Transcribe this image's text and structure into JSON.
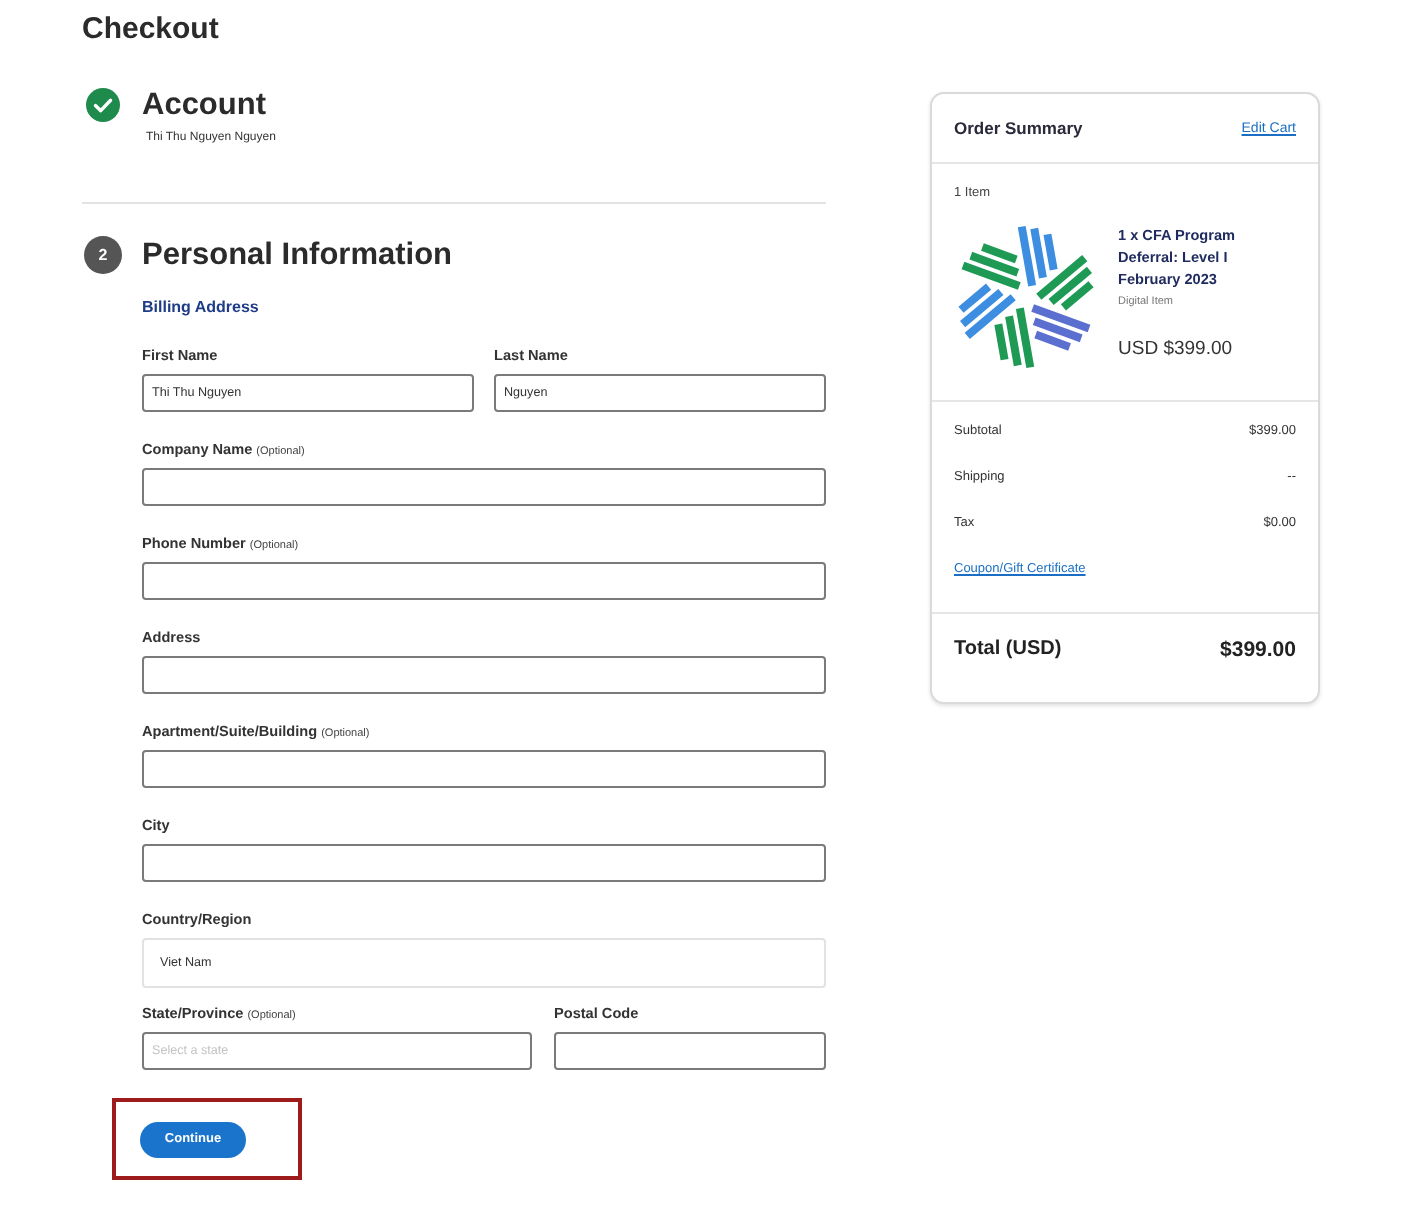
{
  "page": {
    "title": "Checkout"
  },
  "steps": [
    {
      "title": "Account",
      "completed": true,
      "summary": "Thi Thu Nguyen Nguyen"
    },
    {
      "title": "Personal Information",
      "completed": false,
      "number": "2",
      "form": {
        "heading": "Billing Address",
        "rows": [
          {
            "fields": [
              {
                "kind": "text",
                "label": "First Name",
                "value": "Thi Thu Nguyen"
              },
              {
                "kind": "text",
                "label": "Last Name",
                "value": "Nguyen"
              }
            ]
          },
          {
            "fields": [
              {
                "kind": "text",
                "label": "Company Name",
                "note": "(Optional)"
              }
            ]
          },
          {
            "fields": [
              {
                "kind": "text",
                "label": "Phone Number",
                "note": "(Optional)"
              }
            ]
          },
          {
            "fields": [
              {
                "kind": "text",
                "label": "Address"
              }
            ]
          },
          {
            "fields": [
              {
                "kind": "text",
                "label": "Apartment/Suite/Building",
                "note": "(Optional)"
              }
            ]
          },
          {
            "fields": [
              {
                "kind": "text",
                "label": "City"
              }
            ]
          },
          {
            "fields": [
              {
                "kind": "dropdown",
                "label": "Country/Region",
                "value": "Viet Nam"
              }
            ]
          },
          {
            "fields": [
              {
                "kind": "text",
                "label": "State/Province",
                "note": "(Optional)",
                "placeholder": "Select a state"
              },
              {
                "kind": "text",
                "label": "Postal Code"
              }
            ]
          }
        ],
        "button": {
          "label": "Continue",
          "highlighted": true
        }
      }
    }
  ],
  "order_summary": {
    "title": "Order Summary",
    "edit_link": "Edit Cart",
    "item_count": "1 Item",
    "items": [
      {
        "name": "1 x CFA Program Deferral: Level I February 2023",
        "type": "Digital Item",
        "price": "USD $399.00"
      }
    ],
    "totals": [
      {
        "label": "Subtotal",
        "value": "$399.00"
      },
      {
        "label": "Shipping",
        "value": "--"
      },
      {
        "label": "Tax",
        "value": "$0.00"
      }
    ],
    "coupon_link": "Coupon/Gift Certificate",
    "total": {
      "label": "Total (USD)",
      "value": "$399.00"
    }
  }
}
